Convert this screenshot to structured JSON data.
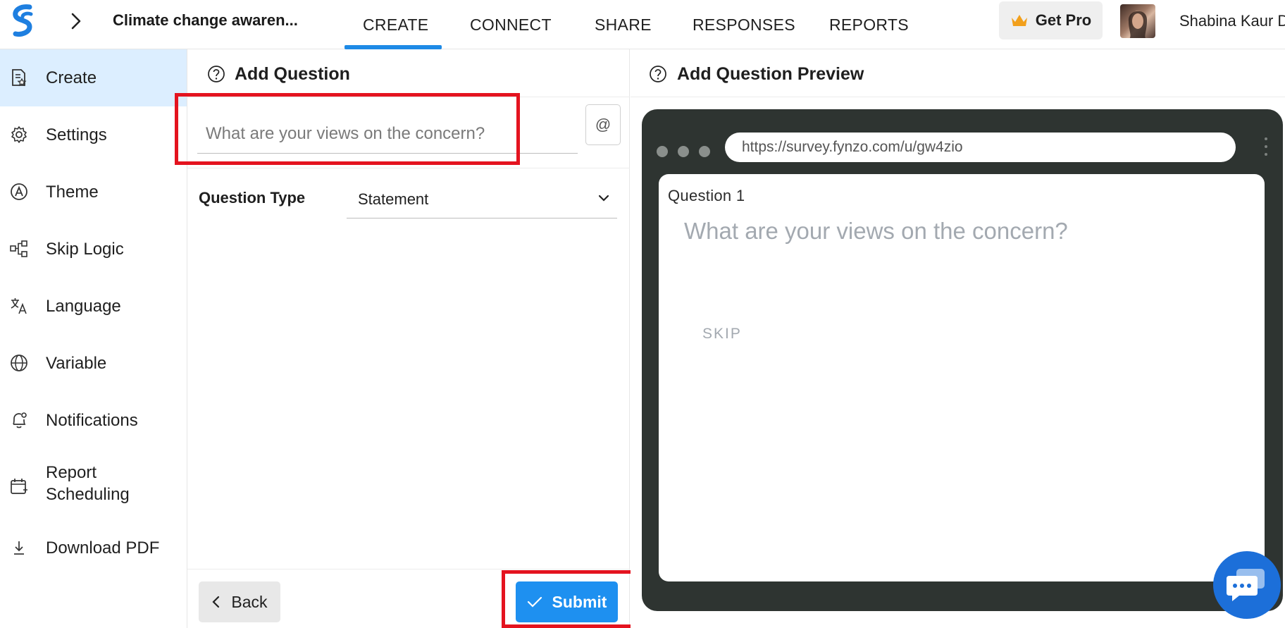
{
  "header": {
    "survey_title": "Climate change awaren...",
    "tabs": [
      {
        "label": "CREATE",
        "active": true
      },
      {
        "label": "CONNECT"
      },
      {
        "label": "SHARE"
      },
      {
        "label": "RESPONSES"
      },
      {
        "label": "REPORTS"
      }
    ],
    "get_pro_label": "Get Pro",
    "user_name": "Shabina Kaur D"
  },
  "sidebar": {
    "items": [
      {
        "label": "Create",
        "icon": "create-doc-icon",
        "active": true
      },
      {
        "label": "Settings",
        "icon": "gear-icon"
      },
      {
        "label": "Theme",
        "icon": "theme-icon"
      },
      {
        "label": "Skip Logic",
        "icon": "skip-logic-icon"
      },
      {
        "label": "Language",
        "icon": "translate-icon"
      },
      {
        "label": "Variable",
        "icon": "globe-icon"
      },
      {
        "label": "Notifications",
        "icon": "bell-icon"
      },
      {
        "label": "Report Scheduling",
        "icon": "calendar-icon"
      },
      {
        "label": "Download PDF",
        "icon": "download-icon"
      }
    ]
  },
  "add_question": {
    "title": "Add Question",
    "question_input": {
      "value": "",
      "placeholder": "What are your views on the concern?"
    },
    "mention_button": "@",
    "question_type_label": "Question Type",
    "question_type_value": "Statement",
    "back_label": "Back",
    "submit_label": "Submit"
  },
  "preview": {
    "title": "Add Question Preview",
    "url": "https://survey.fynzo.com/u/gw4zio",
    "question_number": "Question 1",
    "question_text": "What are your views on the concern?",
    "skip_label": "SKIP"
  },
  "colors": {
    "accent": "#1e8ae6",
    "submit": "#1e90f0",
    "active_sidebar": "#dceeff",
    "highlight": "#e4131f",
    "browser_frame": "#2e3431",
    "chat": "#1c6fd9"
  }
}
